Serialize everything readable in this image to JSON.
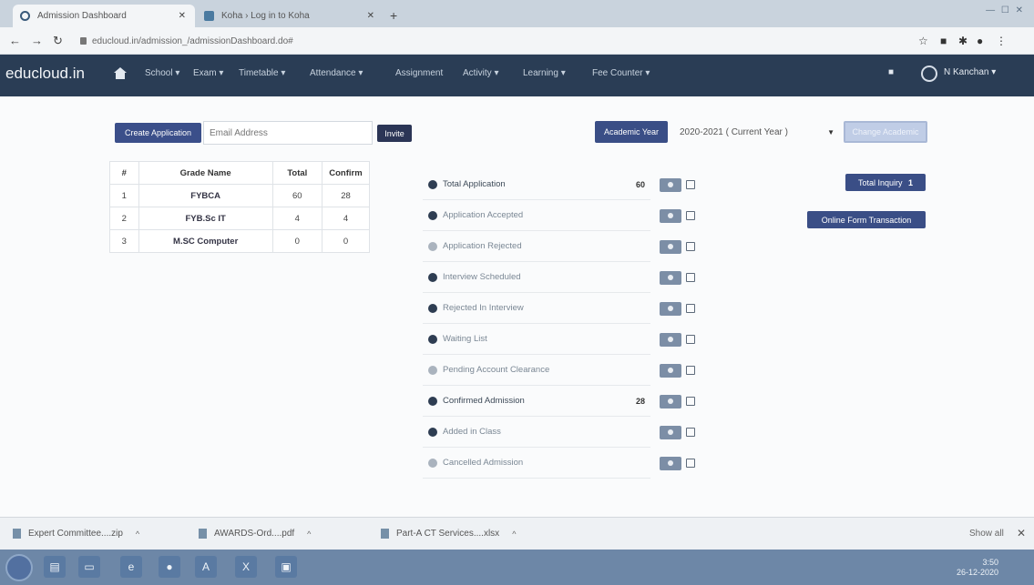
{
  "browser": {
    "tabs": [
      {
        "title": "Admission Dashboard",
        "active": true
      },
      {
        "title": "Koha › Log in to Koha",
        "active": false
      }
    ],
    "url": "educloud.in/admission_/admissionDashboard.do#",
    "icons": {
      "back": "arrow-left-icon",
      "forward": "arrow-right-icon",
      "reload": "reload-icon",
      "star": "star-icon",
      "lock": "lock-icon"
    }
  },
  "nav": {
    "brand": "educloud.in",
    "menu": [
      {
        "label": "School ▾"
      },
      {
        "label": "Exam ▾"
      },
      {
        "label": "Timetable ▾"
      },
      {
        "label": "Attendance ▾"
      },
      {
        "label": "Assignment"
      },
      {
        "label": "Activity ▾"
      },
      {
        "label": "Learning ▾"
      },
      {
        "label": "Fee Counter ▾"
      }
    ],
    "user": "N Kanchan ▾",
    "colors": {
      "navbar": "#2a3d55",
      "primary_button": "#3a4e86"
    }
  },
  "toolbar": {
    "create_label": "Create Application",
    "email_placeholder": "Email Address",
    "invite_label": "Invite",
    "academic_year_label": "Academic Year",
    "year_value": "2020-2021 ( Current Year )",
    "change_label": "Change Academic"
  },
  "grades": {
    "headers": [
      "#",
      "Grade Name",
      "Total",
      "Confirm"
    ],
    "rows": [
      {
        "no": "1",
        "name": "FYBCA",
        "total": "60",
        "confirm": "28"
      },
      {
        "no": "2",
        "name": "FYB.Sc IT",
        "total": "4",
        "confirm": "4"
      },
      {
        "no": "3",
        "name": "M.SC Computer",
        "total": "0",
        "confirm": "0"
      }
    ]
  },
  "statuses": [
    {
      "label": "Total Application",
      "count": "60",
      "tone": "dark"
    },
    {
      "label": "Application Accepted",
      "count": "",
      "tone": "light"
    },
    {
      "label": "Application Rejected",
      "count": "",
      "tone": "light"
    },
    {
      "label": "Interview Scheduled",
      "count": "",
      "tone": "light"
    },
    {
      "label": "Rejected In Interview",
      "count": "",
      "tone": "light"
    },
    {
      "label": "Waiting List",
      "count": "",
      "tone": "light"
    },
    {
      "label": "Pending Account Clearance",
      "count": "",
      "tone": "light"
    },
    {
      "label": "Confirmed Admission",
      "count": "28",
      "tone": "dark"
    },
    {
      "label": "Added in Class",
      "count": "",
      "tone": "light"
    },
    {
      "label": "Cancelled Admission",
      "count": "",
      "tone": "light"
    }
  ],
  "side": {
    "inquiry_label": "Total Inquiry",
    "inquiry_count": "1",
    "online_label": "Online Form Transaction"
  },
  "downloads": {
    "items": [
      "Expert Committee....zip",
      "AWARDS-Ord....pdf",
      "Part-A CT Services....xlsx"
    ],
    "show_all": "Show all"
  },
  "taskbar": {
    "time": "3:50",
    "date": "26-12-2020"
  }
}
